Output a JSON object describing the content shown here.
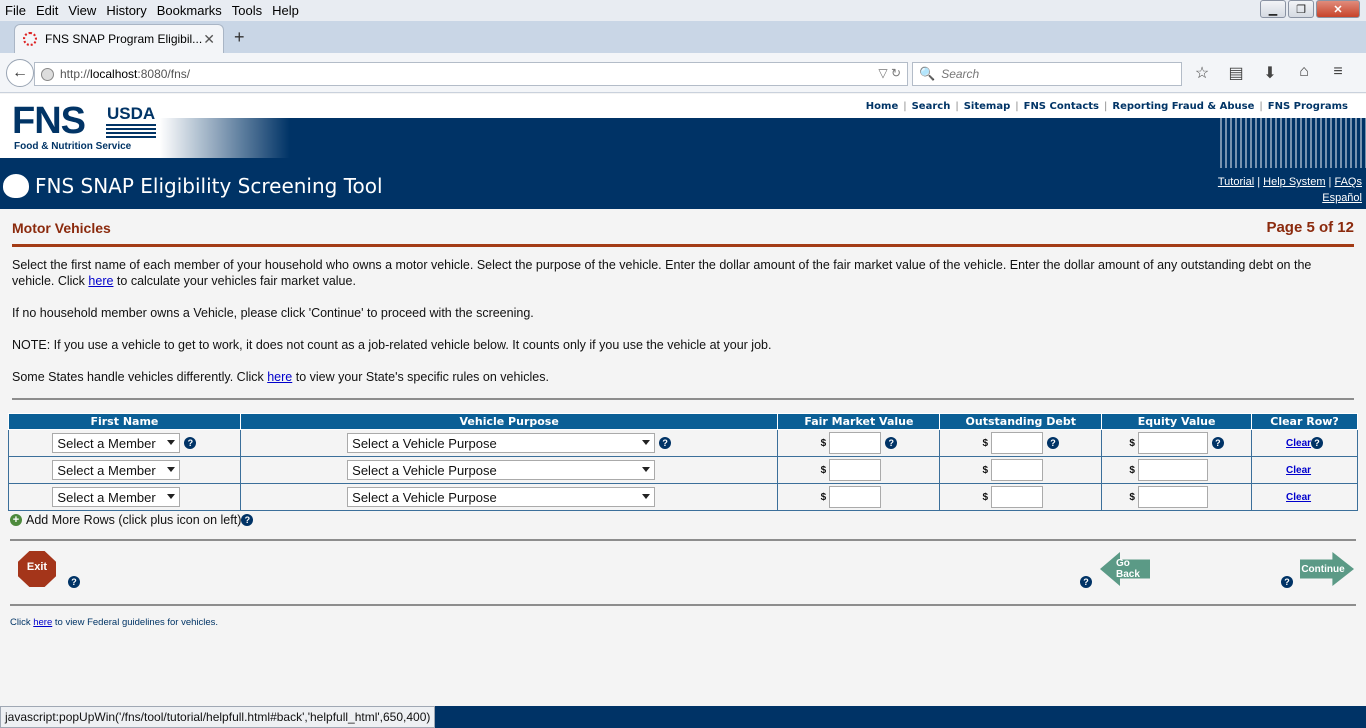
{
  "browser": {
    "menu": [
      "File",
      "Edit",
      "View",
      "History",
      "Bookmarks",
      "Tools",
      "Help"
    ],
    "tab_title": "FNS SNAP Program Eligibil...",
    "url_prefix": "http://",
    "url_host": "localhost",
    "url_rest": ":8080/fns/",
    "search_placeholder": "Search"
  },
  "header": {
    "logo_fns": "FNS",
    "logo_usda": "USDA",
    "logo_full": "Food & Nutrition Service",
    "top_links": [
      "Home",
      "Search",
      "Sitemap",
      "FNS Contacts",
      "Reporting Fraud & Abuse",
      "FNS Programs"
    ],
    "app_title": "FNS SNAP Eligibility Screening Tool",
    "help_links": {
      "tutorial": "Tutorial",
      "help": " Help System",
      "faqs": "FAQs",
      "espanol": "Español",
      "sep": " | "
    }
  },
  "page": {
    "section_title": "Motor Vehicles",
    "page_indicator": "Page 5 of 12",
    "intro_1a": "Select the first name of each member of your household who owns a motor vehicle. Select the purpose of the vehicle. Enter the dollar amount of the fair market value of the vehicle. Enter the dollar amount of any outstanding debt on the vehicle. Click ",
    "intro_1_link": "here",
    "intro_1b": " to calculate your vehicles fair market value.",
    "intro_2": "If no household member owns a Vehicle, please click 'Continue' to proceed with the screening.",
    "intro_3": "NOTE: If you use a vehicle to get to work, it does not count as a job-related vehicle below. It counts only if you use the vehicle at your job.",
    "intro_4a": "Some States handle vehicles differently. Click ",
    "intro_4_link": "here",
    "intro_4b": " to view your State's specific rules on vehicles."
  },
  "table": {
    "headers": [
      "First Name",
      "Vehicle Purpose",
      "Fair Market Value",
      "Outstanding Debt",
      "Equity Value",
      "Clear Row?"
    ],
    "member_placeholder": "Select a Member",
    "purpose_placeholder": "Select a Vehicle Purpose",
    "currency": "$",
    "clear_label": "Clear",
    "help_glyph": "?",
    "rows": 3
  },
  "actions": {
    "add_rows": "Add More Rows (click plus icon on left)",
    "exit": "Exit",
    "go_back": "Go Back",
    "continue": "Continue"
  },
  "footer": {
    "note_a": "Click ",
    "note_link": "here",
    "note_b": " to view Federal guidelines for vehicles."
  },
  "statusbar": {
    "text": "javascript:popUpWin('/fns/tool/tutorial/helpfull.html#back','helpfull_html',650,400)"
  },
  "colors": {
    "navy": "#003366",
    "header_table": "#0b5f96",
    "accent_red": "#8b2a0d",
    "button_green": "#5b9a86"
  }
}
